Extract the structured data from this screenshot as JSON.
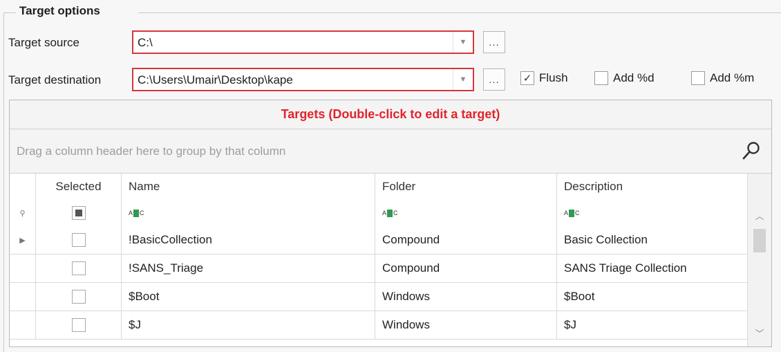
{
  "group": {
    "title": "Target options"
  },
  "target_source": {
    "label": "Target source",
    "value": "C:\\",
    "browse_label": "..."
  },
  "target_destination": {
    "label": "Target destination",
    "value": "C:\\Users\\Umair\\Desktop\\kape",
    "browse_label": "..."
  },
  "options": {
    "flush": {
      "label": "Flush",
      "checked": true
    },
    "add_d": {
      "label": "Add %d",
      "checked": false
    },
    "add_m": {
      "label": "Add %m",
      "checked": false
    }
  },
  "grid": {
    "caption": "Targets (Double-click to edit a target)",
    "group_panel_hint": "Drag a column header here to group by that column",
    "columns": [
      "Selected",
      "Name",
      "Folder",
      "Description"
    ],
    "filter_icon": "abc-filter-icon",
    "rows": [
      {
        "selected": false,
        "name": "!BasicCollection",
        "folder": "Compound",
        "description": "Basic Collection"
      },
      {
        "selected": false,
        "name": "!SANS_Triage",
        "folder": "Compound",
        "description": "SANS Triage Collection"
      },
      {
        "selected": false,
        "name": "$Boot",
        "folder": "Windows",
        "description": "$Boot"
      },
      {
        "selected": false,
        "name": "$J",
        "folder": "Windows",
        "description": "$J"
      }
    ]
  },
  "colors": {
    "caption": "#e3232b",
    "invalid_border": "#d9343d",
    "filter_icon": "#2f9a52"
  }
}
